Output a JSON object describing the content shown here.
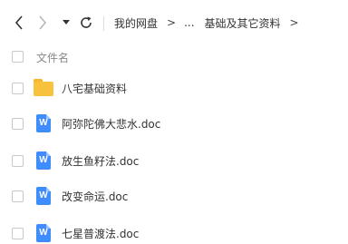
{
  "toolbar": {
    "back_icon": "chevron-left-icon",
    "forward_icon": "chevron-right-icon",
    "dropdown_icon": "caret-down-icon",
    "refresh_icon": "refresh-icon"
  },
  "breadcrumb": {
    "root": "我的网盘",
    "sep1": ">",
    "ellipsis": "...",
    "current": "基础及其它资料",
    "sep2": ">"
  },
  "list_header": {
    "filename_label": "文件名"
  },
  "files": [
    {
      "name": "八宅基础资料",
      "type": "folder"
    },
    {
      "name": "阿弥陀佛大悲水.doc",
      "type": "doc"
    },
    {
      "name": "放生鱼籽法.doc",
      "type": "doc"
    },
    {
      "name": "改变命运.doc",
      "type": "doc"
    },
    {
      "name": "七星普渡法.doc",
      "type": "doc"
    }
  ],
  "colors": {
    "folder": "#f9c23c",
    "doc": "#3f8cfe"
  }
}
